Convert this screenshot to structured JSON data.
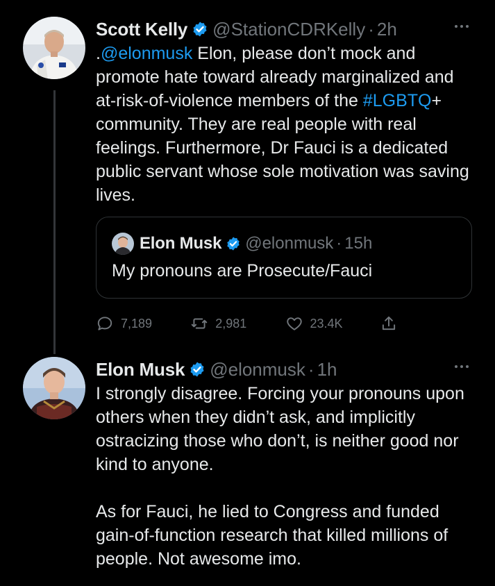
{
  "thread": [
    {
      "author": {
        "display_name": "Scott Kelly",
        "handle": "@StationCDRKelly",
        "time": "2h"
      },
      "text": {
        "prefix": ".",
        "mention": "@elonmusk",
        "part1": " Elon, please don’t mock and promote hate toward already marginalized and at-risk-of-violence members of the ",
        "hashtag": "#LGBTQ",
        "part2": "+ community. They are real people with real feelings. Furthermore, Dr Fauci is a dedicated public servant whose sole motivation was saving lives."
      },
      "quote": {
        "display_name": "Elon Musk",
        "handle": "@elonmusk",
        "time": "15h",
        "text": "My pronouns are Prosecute/Fauci"
      },
      "actions": {
        "replies": "7,189",
        "retweets": "2,981",
        "likes": "23.4K"
      }
    },
    {
      "author": {
        "display_name": "Elon Musk",
        "handle": "@elonmusk",
        "time": "1h"
      },
      "paragraphs": [
        "I strongly disagree. Forcing your pronouns upon others when they didn’t ask, and implicitly ostracizing those who don’t, is neither good nor kind to anyone.",
        "As for Fauci, he lied to Congress and funded gain-of-function research that killed millions of people. Not awesome imo."
      ]
    }
  ],
  "separator": "·",
  "colors": {
    "background": "#000000",
    "text": "#e7e9ea",
    "secondary": "#71767b",
    "link": "#1d9bf0",
    "verified": "#1d9bf0",
    "border": "#2f3336"
  }
}
